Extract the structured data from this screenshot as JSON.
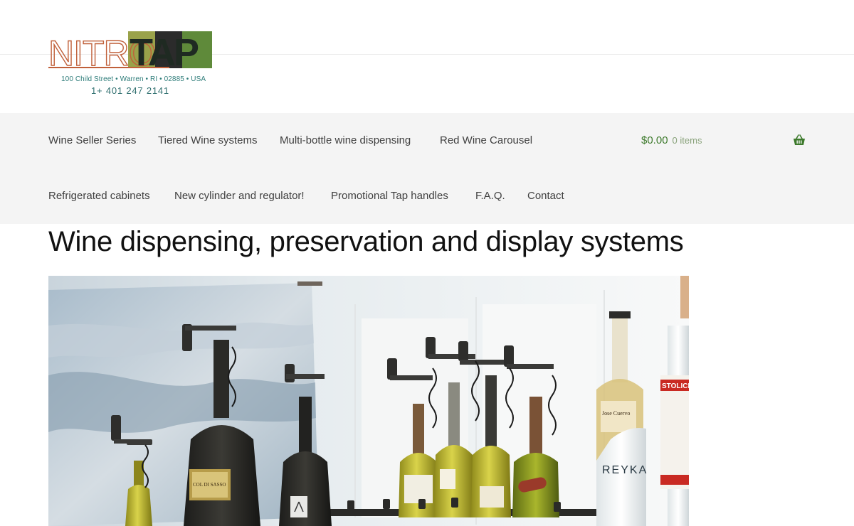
{
  "logo": {
    "brand_left": "NITRO",
    "brand_right": "TAP",
    "address": "100 Child Street • Warren • RI • 02885 • USA",
    "phone": "1+ 401 247 2141",
    "colors": {
      "orange": "#c0603a",
      "teal": "#2f7d7a",
      "green": "#5f8a3a",
      "dark": "#2b2b2b",
      "olive": "#9aa24a"
    }
  },
  "nav": {
    "items_row1": [
      {
        "label": "Wine Seller Series"
      },
      {
        "label": "Tiered Wine systems"
      },
      {
        "label": "Multi-bottle wine dispensing"
      },
      {
        "label": "Red Wine Carousel"
      }
    ],
    "items_row2": [
      {
        "label": "Refrigerated cabinets"
      },
      {
        "label": "New cylinder and regulator!"
      },
      {
        "label": "Promotional Tap handles"
      },
      {
        "label": "F.A.Q."
      },
      {
        "label": "Contact"
      }
    ],
    "background": "#f4f4f4"
  },
  "cart": {
    "amount": "$0.00",
    "count": "0 items",
    "icon": "basket-icon",
    "accent": "#3d7a2c"
  },
  "main": {
    "title": "Wine dispensing, preservation and display systems"
  },
  "hero": {
    "bottle_labels": {
      "magnum": "COL DI SASSO",
      "tequila": "Jose Cuervo",
      "vodka_left": "REYKA",
      "vodka_right": "STOLICH"
    }
  }
}
